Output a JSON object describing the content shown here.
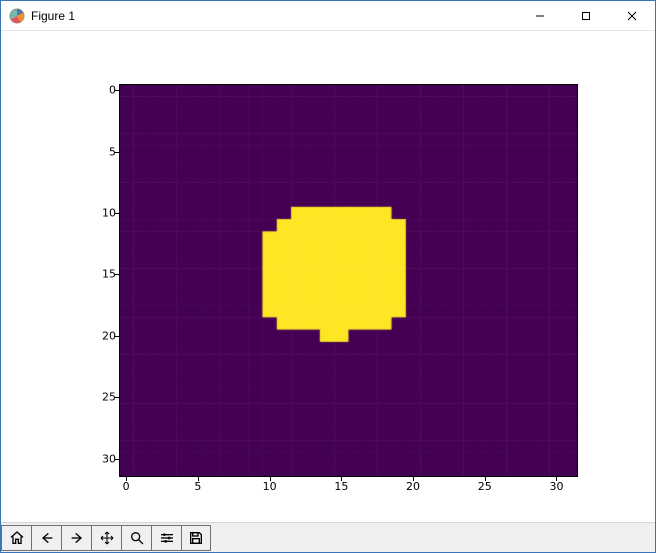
{
  "window": {
    "title": "Figure 1",
    "min_label": "Minimize",
    "max_label": "Maximize",
    "close_label": "Close"
  },
  "toolbar": {
    "home": "Home",
    "back": "Back",
    "forward": "Forward",
    "pan": "Pan",
    "zoom": "Zoom",
    "subplots": "Configure subplots",
    "save": "Save"
  },
  "chart_data": {
    "type": "heatmap",
    "title": "",
    "xlabel": "",
    "ylabel": "",
    "xlim": [
      -0.5,
      31.5
    ],
    "ylim": [
      31.5,
      -0.5
    ],
    "x_ticks": [
      0,
      5,
      10,
      15,
      20,
      25,
      30
    ],
    "y_ticks": [
      0,
      5,
      10,
      15,
      20,
      25,
      30
    ],
    "colormap": "viridis",
    "background_value": 0,
    "foreground_value": 1,
    "colors": {
      "0": "#440154",
      "1": "#fde725"
    },
    "shape": "Roughly circular/blob mask centered near (15,15), radius ~5 cells, on 32x32 grid",
    "grid": [
      [
        0,
        0,
        0,
        0,
        0,
        0,
        0,
        0,
        0,
        0,
        0,
        0,
        0,
        0,
        0,
        0,
        0,
        0,
        0,
        0,
        0,
        0,
        0,
        0,
        0,
        0,
        0,
        0,
        0,
        0,
        0,
        0
      ],
      [
        0,
        0,
        0,
        0,
        0,
        0,
        0,
        0,
        0,
        0,
        0,
        0,
        0,
        0,
        0,
        0,
        0,
        0,
        0,
        0,
        0,
        0,
        0,
        0,
        0,
        0,
        0,
        0,
        0,
        0,
        0,
        0
      ],
      [
        0,
        0,
        0,
        0,
        0,
        0,
        0,
        0,
        0,
        0,
        0,
        0,
        0,
        0,
        0,
        0,
        0,
        0,
        0,
        0,
        0,
        0,
        0,
        0,
        0,
        0,
        0,
        0,
        0,
        0,
        0,
        0
      ],
      [
        0,
        0,
        0,
        0,
        0,
        0,
        0,
        0,
        0,
        0,
        0,
        0,
        0,
        0,
        0,
        0,
        0,
        0,
        0,
        0,
        0,
        0,
        0,
        0,
        0,
        0,
        0,
        0,
        0,
        0,
        0,
        0
      ],
      [
        0,
        0,
        0,
        0,
        0,
        0,
        0,
        0,
        0,
        0,
        0,
        0,
        0,
        0,
        0,
        0,
        0,
        0,
        0,
        0,
        0,
        0,
        0,
        0,
        0,
        0,
        0,
        0,
        0,
        0,
        0,
        0
      ],
      [
        0,
        0,
        0,
        0,
        0,
        0,
        0,
        0,
        0,
        0,
        0,
        0,
        0,
        0,
        0,
        0,
        0,
        0,
        0,
        0,
        0,
        0,
        0,
        0,
        0,
        0,
        0,
        0,
        0,
        0,
        0,
        0
      ],
      [
        0,
        0,
        0,
        0,
        0,
        0,
        0,
        0,
        0,
        0,
        0,
        0,
        0,
        0,
        0,
        0,
        0,
        0,
        0,
        0,
        0,
        0,
        0,
        0,
        0,
        0,
        0,
        0,
        0,
        0,
        0,
        0
      ],
      [
        0,
        0,
        0,
        0,
        0,
        0,
        0,
        0,
        0,
        0,
        0,
        0,
        0,
        0,
        0,
        0,
        0,
        0,
        0,
        0,
        0,
        0,
        0,
        0,
        0,
        0,
        0,
        0,
        0,
        0,
        0,
        0
      ],
      [
        0,
        0,
        0,
        0,
        0,
        0,
        0,
        0,
        0,
        0,
        0,
        0,
        0,
        0,
        0,
        0,
        0,
        0,
        0,
        0,
        0,
        0,
        0,
        0,
        0,
        0,
        0,
        0,
        0,
        0,
        0,
        0
      ],
      [
        0,
        0,
        0,
        0,
        0,
        0,
        0,
        0,
        0,
        0,
        0,
        0,
        0,
        0,
        0,
        0,
        0,
        0,
        0,
        0,
        0,
        0,
        0,
        0,
        0,
        0,
        0,
        0,
        0,
        0,
        0,
        0
      ],
      [
        0,
        0,
        0,
        0,
        0,
        0,
        0,
        0,
        0,
        0,
        0,
        0,
        1,
        1,
        1,
        1,
        1,
        1,
        1,
        0,
        0,
        0,
        0,
        0,
        0,
        0,
        0,
        0,
        0,
        0,
        0,
        0
      ],
      [
        0,
        0,
        0,
        0,
        0,
        0,
        0,
        0,
        0,
        0,
        0,
        1,
        1,
        1,
        1,
        1,
        1,
        1,
        1,
        1,
        0,
        0,
        0,
        0,
        0,
        0,
        0,
        0,
        0,
        0,
        0,
        0
      ],
      [
        0,
        0,
        0,
        0,
        0,
        0,
        0,
        0,
        0,
        0,
        1,
        1,
        1,
        1,
        1,
        1,
        1,
        1,
        1,
        1,
        0,
        0,
        0,
        0,
        0,
        0,
        0,
        0,
        0,
        0,
        0,
        0
      ],
      [
        0,
        0,
        0,
        0,
        0,
        0,
        0,
        0,
        0,
        0,
        1,
        1,
        1,
        1,
        1,
        1,
        1,
        1,
        1,
        1,
        0,
        0,
        0,
        0,
        0,
        0,
        0,
        0,
        0,
        0,
        0,
        0
      ],
      [
        0,
        0,
        0,
        0,
        0,
        0,
        0,
        0,
        0,
        0,
        1,
        1,
        1,
        1,
        1,
        1,
        1,
        1,
        1,
        1,
        0,
        0,
        0,
        0,
        0,
        0,
        0,
        0,
        0,
        0,
        0,
        0
      ],
      [
        0,
        0,
        0,
        0,
        0,
        0,
        0,
        0,
        0,
        0,
        1,
        1,
        1,
        1,
        1,
        1,
        1,
        1,
        1,
        1,
        0,
        0,
        0,
        0,
        0,
        0,
        0,
        0,
        0,
        0,
        0,
        0
      ],
      [
        0,
        0,
        0,
        0,
        0,
        0,
        0,
        0,
        0,
        0,
        1,
        1,
        1,
        1,
        1,
        1,
        1,
        1,
        1,
        1,
        0,
        0,
        0,
        0,
        0,
        0,
        0,
        0,
        0,
        0,
        0,
        0
      ],
      [
        0,
        0,
        0,
        0,
        0,
        0,
        0,
        0,
        0,
        0,
        1,
        1,
        1,
        1,
        1,
        1,
        1,
        1,
        1,
        1,
        0,
        0,
        0,
        0,
        0,
        0,
        0,
        0,
        0,
        0,
        0,
        0
      ],
      [
        0,
        0,
        0,
        0,
        0,
        0,
        0,
        0,
        0,
        0,
        1,
        1,
        1,
        1,
        1,
        1,
        1,
        1,
        1,
        1,
        0,
        0,
        0,
        0,
        0,
        0,
        0,
        0,
        0,
        0,
        0,
        0
      ],
      [
        0,
        0,
        0,
        0,
        0,
        0,
        0,
        0,
        0,
        0,
        0,
        1,
        1,
        1,
        1,
        1,
        1,
        1,
        1,
        0,
        0,
        0,
        0,
        0,
        0,
        0,
        0,
        0,
        0,
        0,
        0,
        0
      ],
      [
        0,
        0,
        0,
        0,
        0,
        0,
        0,
        0,
        0,
        0,
        0,
        0,
        0,
        0,
        1,
        1,
        0,
        0,
        0,
        0,
        0,
        0,
        0,
        0,
        0,
        0,
        0,
        0,
        0,
        0,
        0,
        0
      ],
      [
        0,
        0,
        0,
        0,
        0,
        0,
        0,
        0,
        0,
        0,
        0,
        0,
        0,
        0,
        0,
        0,
        0,
        0,
        0,
        0,
        0,
        0,
        0,
        0,
        0,
        0,
        0,
        0,
        0,
        0,
        0,
        0
      ],
      [
        0,
        0,
        0,
        0,
        0,
        0,
        0,
        0,
        0,
        0,
        0,
        0,
        0,
        0,
        0,
        0,
        0,
        0,
        0,
        0,
        0,
        0,
        0,
        0,
        0,
        0,
        0,
        0,
        0,
        0,
        0,
        0
      ],
      [
        0,
        0,
        0,
        0,
        0,
        0,
        0,
        0,
        0,
        0,
        0,
        0,
        0,
        0,
        0,
        0,
        0,
        0,
        0,
        0,
        0,
        0,
        0,
        0,
        0,
        0,
        0,
        0,
        0,
        0,
        0,
        0
      ],
      [
        0,
        0,
        0,
        0,
        0,
        0,
        0,
        0,
        0,
        0,
        0,
        0,
        0,
        0,
        0,
        0,
        0,
        0,
        0,
        0,
        0,
        0,
        0,
        0,
        0,
        0,
        0,
        0,
        0,
        0,
        0,
        0
      ],
      [
        0,
        0,
        0,
        0,
        0,
        0,
        0,
        0,
        0,
        0,
        0,
        0,
        0,
        0,
        0,
        0,
        0,
        0,
        0,
        0,
        0,
        0,
        0,
        0,
        0,
        0,
        0,
        0,
        0,
        0,
        0,
        0
      ],
      [
        0,
        0,
        0,
        0,
        0,
        0,
        0,
        0,
        0,
        0,
        0,
        0,
        0,
        0,
        0,
        0,
        0,
        0,
        0,
        0,
        0,
        0,
        0,
        0,
        0,
        0,
        0,
        0,
        0,
        0,
        0,
        0
      ],
      [
        0,
        0,
        0,
        0,
        0,
        0,
        0,
        0,
        0,
        0,
        0,
        0,
        0,
        0,
        0,
        0,
        0,
        0,
        0,
        0,
        0,
        0,
        0,
        0,
        0,
        0,
        0,
        0,
        0,
        0,
        0,
        0
      ],
      [
        0,
        0,
        0,
        0,
        0,
        0,
        0,
        0,
        0,
        0,
        0,
        0,
        0,
        0,
        0,
        0,
        0,
        0,
        0,
        0,
        0,
        0,
        0,
        0,
        0,
        0,
        0,
        0,
        0,
        0,
        0,
        0
      ],
      [
        0,
        0,
        0,
        0,
        0,
        0,
        0,
        0,
        0,
        0,
        0,
        0,
        0,
        0,
        0,
        0,
        0,
        0,
        0,
        0,
        0,
        0,
        0,
        0,
        0,
        0,
        0,
        0,
        0,
        0,
        0,
        0
      ],
      [
        0,
        0,
        0,
        0,
        0,
        0,
        0,
        0,
        0,
        0,
        0,
        0,
        0,
        0,
        0,
        0,
        0,
        0,
        0,
        0,
        0,
        0,
        0,
        0,
        0,
        0,
        0,
        0,
        0,
        0,
        0,
        0
      ],
      [
        0,
        0,
        0,
        0,
        0,
        0,
        0,
        0,
        0,
        0,
        0,
        0,
        0,
        0,
        0,
        0,
        0,
        0,
        0,
        0,
        0,
        0,
        0,
        0,
        0,
        0,
        0,
        0,
        0,
        0,
        0,
        0
      ]
    ]
  }
}
